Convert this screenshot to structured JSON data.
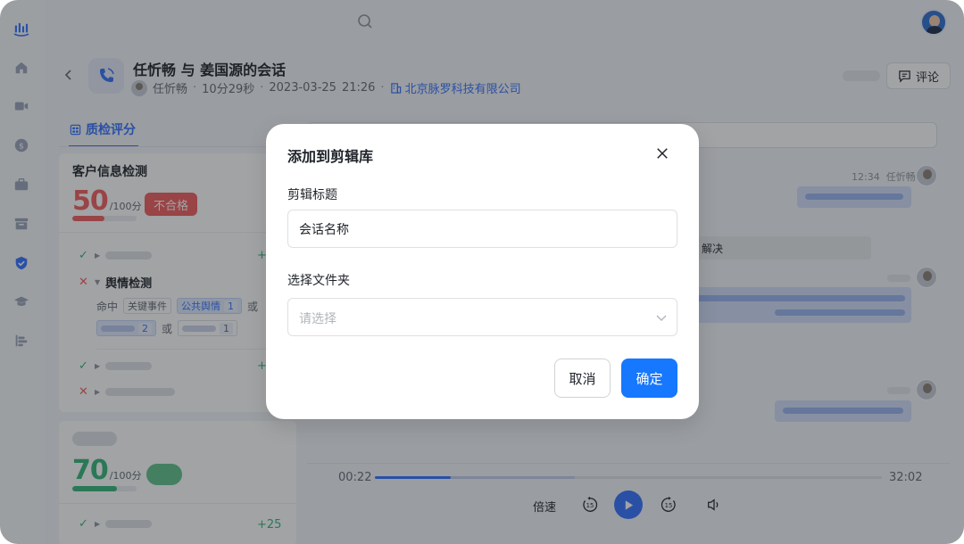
{
  "header": {
    "title": "任忻畅 与 姜国源的会话",
    "participant": "任忻畅",
    "duration": "10分29秒",
    "date": "2023-03-25",
    "time": "21:26",
    "company": "北京脉罗科技有限公司",
    "comment_label": "评论"
  },
  "tabs": [
    {
      "label": "质检评分"
    }
  ],
  "score_cards": [
    {
      "title": "客户信息检测",
      "score": "50",
      "total": "/100分",
      "status": "不合格",
      "items": {
        "subsection_title": "舆情检测",
        "hit_prefix": "命中",
        "tag1": "关键事件",
        "tag2": "公共舆情",
        "tag2_count": "1",
        "or1": "或",
        "count2": "2",
        "or2": "或",
        "count3": "1"
      }
    },
    {
      "score": "70",
      "total": "/100分",
      "plus": "+25"
    }
  ],
  "chat": {
    "time": "12:34",
    "speaker": "任忻畅",
    "fragment": "解决"
  },
  "player": {
    "current_time": "00:22",
    "total_time": "32:02",
    "progress": 0.15,
    "speed_label": "倍速",
    "skip_seconds": "15"
  },
  "modal": {
    "title": "添加到剪辑库",
    "clip_title_label": "剪辑标题",
    "clip_title_value": "会话名称",
    "folder_label": "选择文件夹",
    "folder_placeholder": "请选择",
    "cancel_label": "取消",
    "ok_label": "确定"
  },
  "colors": {
    "accent": "#3370ff",
    "primary_button": "#1677ff",
    "fail": "#f25c5c",
    "pass": "#34b578"
  }
}
